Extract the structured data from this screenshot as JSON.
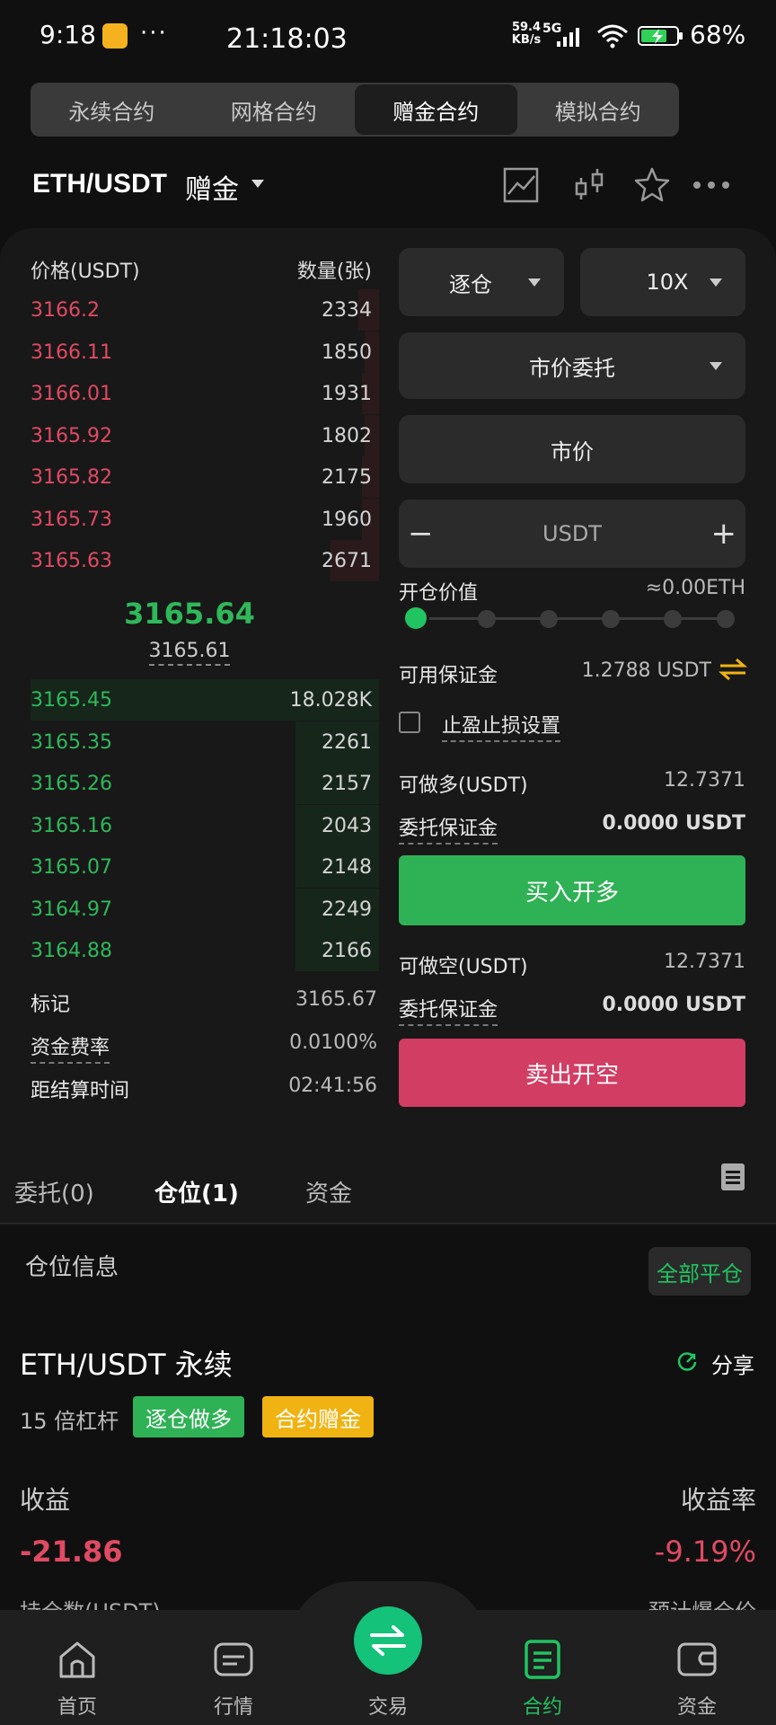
{
  "status_bar": {
    "time": "9:18",
    "dots": "···",
    "clock": "21:18:03",
    "net_speed_value": "59.4",
    "net_speed_unit": "KB/s",
    "network": "5G",
    "battery": "68%"
  },
  "top_tabs": [
    {
      "label": "永续合约"
    },
    {
      "label": "网格合约"
    },
    {
      "label": "赠金合约",
      "active": true
    },
    {
      "label": "模拟合约"
    }
  ],
  "pair": {
    "name": "ETH/USDT",
    "sub": "赠金"
  },
  "order_book": {
    "price_header": "价格(USDT)",
    "qty_header": "数量(张)",
    "asks": [
      {
        "price": "3166.2",
        "qty": "2334",
        "depth": 0.06
      },
      {
        "price": "3166.11",
        "qty": "1850",
        "depth": 0.04
      },
      {
        "price": "3166.01",
        "qty": "1931",
        "depth": 0.05
      },
      {
        "price": "3165.92",
        "qty": "1802",
        "depth": 0.04
      },
      {
        "price": "3165.82",
        "qty": "2175",
        "depth": 0.05
      },
      {
        "price": "3165.73",
        "qty": "1960",
        "depth": 0.05
      },
      {
        "price": "3165.63",
        "qty": "2671",
        "depth": 0.14
      }
    ],
    "last_price": "3165.64",
    "mark_price": "3165.61",
    "bids": [
      {
        "price": "3165.45",
        "qty": "18.028K",
        "depth": 1.0
      },
      {
        "price": "3165.35",
        "qty": "2261",
        "depth": 0.24
      },
      {
        "price": "3165.26",
        "qty": "2157",
        "depth": 0.24
      },
      {
        "price": "3165.16",
        "qty": "2043",
        "depth": 0.24
      },
      {
        "price": "3165.07",
        "qty": "2148",
        "depth": 0.24
      },
      {
        "price": "3164.97",
        "qty": "2249",
        "depth": 0.24
      },
      {
        "price": "3164.88",
        "qty": "2166",
        "depth": 0.24
      }
    ]
  },
  "market_info": {
    "mark_label": "标记",
    "mark_value": "3165.67",
    "funding_label": "资金费率",
    "funding_value": "0.0100%",
    "settle_label": "距结算时间",
    "settle_value": "02:41:56"
  },
  "form": {
    "margin_mode": "逐仓",
    "leverage": "10X",
    "order_type": "市价委托",
    "price_field": "市价",
    "amount_minus": "−",
    "amount_unit": "USDT",
    "amount_plus": "+",
    "open_value_label": "开仓价值",
    "open_value": "≈0.00ETH",
    "slider_percent": 0,
    "available_label": "可用保证金",
    "available_value": "1.2788 USDT",
    "tpsl_label": "止盈止损设置",
    "long_max_label": "可做多(USDT)",
    "long_max_value": "12.7371",
    "long_margin_label": "委托保证金",
    "long_margin_value": "0.0000 USDT",
    "buy_label": "买入开多",
    "short_max_label": "可做空(USDT)",
    "short_max_value": "12.7371",
    "short_margin_label": "委托保证金",
    "short_margin_value": "0.0000 USDT",
    "sell_label": "卖出开空"
  },
  "sub_tabs": [
    {
      "label": "委托(0)"
    },
    {
      "label": "仓位(1)",
      "active": true
    },
    {
      "label": "资金"
    }
  ],
  "position": {
    "title": "仓位信息",
    "close_all": "全部平仓",
    "pair": "ETH/USDT 永续",
    "share": "分享",
    "leverage": "15 倍杠杆",
    "tag_mode": "逐仓做多",
    "tag_bonus": "合约赠金",
    "pnl_label": "收益",
    "pnl_rate_label": "收益率",
    "pnl": "-21.86",
    "pnl_rate": "-9.19%",
    "hold_label": "持仓数(USDT)",
    "liq_label": "预计爆仓价"
  },
  "nav": [
    {
      "label": "首页"
    },
    {
      "label": "行情"
    },
    {
      "label": "交易"
    },
    {
      "label": "合约",
      "active": true
    },
    {
      "label": "资金"
    }
  ],
  "colors": {
    "green": "#2fb155",
    "red": "#d23d64",
    "accent": "#21c461",
    "yellow": "#f0b312"
  }
}
